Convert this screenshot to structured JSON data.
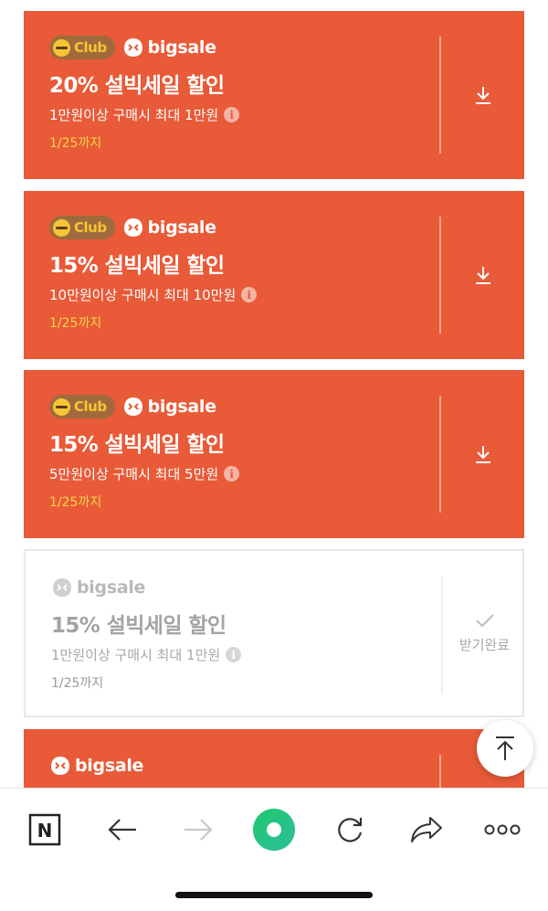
{
  "coupons": [
    {
      "club_label": "Club",
      "brand": "bigsale",
      "title": "20% 설빅세일 할인",
      "condition": "1만원이상 구매시 최대 1만원",
      "expiry": "1/25까지",
      "state": "download"
    },
    {
      "club_label": "Club",
      "brand": "bigsale",
      "title": "15% 설빅세일 할인",
      "condition": "10만원이상 구매시 최대 10만원",
      "expiry": "1/25까지",
      "state": "download"
    },
    {
      "club_label": "Club",
      "brand": "bigsale",
      "title": "15% 설빅세일 할인",
      "condition": "5만원이상 구매시 최대 5만원",
      "expiry": "1/25까지",
      "state": "download"
    },
    {
      "brand": "bigsale",
      "title": "15% 설빅세일 할인",
      "condition": "1만원이상 구매시 최대 1만원",
      "expiry": "1/25까지",
      "state": "received",
      "received_label": "받기완료"
    },
    {
      "brand": "bigsale"
    }
  ],
  "info_glyph": "i",
  "toolbar": {
    "logo_letter": "N",
    "items": [
      "naver-logo-icon",
      "back-arrow-icon",
      "forward-arrow-icon",
      "green-dot-icon",
      "refresh-icon",
      "share-icon",
      "more-icon"
    ]
  },
  "colors": {
    "coupon_bg": "#e85a38",
    "club_badge": "#9f6b3c",
    "club_yellow": "#f6c534",
    "expiry_yellow": "#f8d547",
    "green_button": "#2fcc6b"
  }
}
